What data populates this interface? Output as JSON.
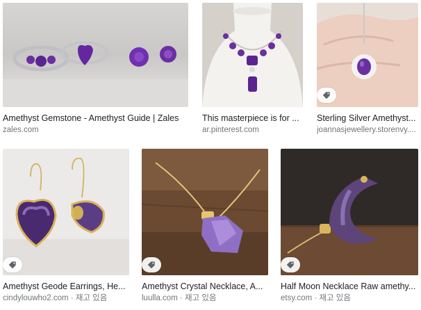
{
  "results": [
    {
      "title": "Amethyst Gemstone - Amethyst Guide | Zales",
      "source": "zales.com",
      "stock": "",
      "tag_badge": false
    },
    {
      "title": "This masterpiece is for ...",
      "source": "ar.pinterest.com",
      "stock": "",
      "tag_badge": false
    },
    {
      "title": "Sterling Silver Amethyst...",
      "source": "joannasjewellery.storenvy....",
      "stock": "",
      "tag_badge": true
    },
    {
      "title": "Amethyst Geode Earrings, He...",
      "source": "cindylouwho2.com",
      "stock": " · 재고 있음",
      "tag_badge": true
    },
    {
      "title": "Amethyst Crystal Necklace, A...",
      "source": "luulla.com",
      "stock": " · 재고 있음",
      "tag_badge": true
    },
    {
      "title": "Half Moon Necklace Raw amethy...",
      "source": "etsy.com",
      "stock": " · 재고 있음",
      "tag_badge": true
    }
  ],
  "icons": {
    "tag": "price-tag-icon"
  },
  "colors": {
    "amethyst": "#6a2fa0",
    "title_text": "#202124",
    "source_text": "#70757a"
  }
}
